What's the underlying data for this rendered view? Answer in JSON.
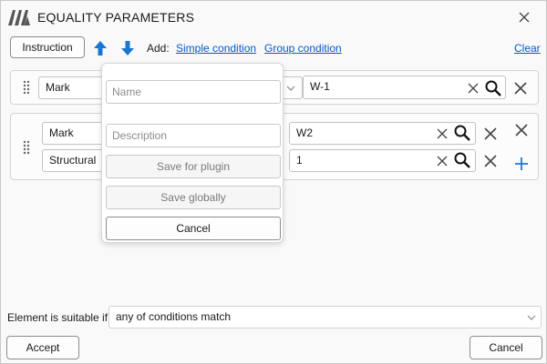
{
  "window": {
    "title": "EQUALITY PARAMETERS",
    "logo_icon": "app-logo-icon",
    "close_icon": "close-icon"
  },
  "toolbar": {
    "instruction_label": "Instruction",
    "move_up_icon": "arrow-up-icon",
    "move_down_icon": "arrow-down-icon",
    "add_label": "Add:",
    "simple_condition_label": "Simple condition",
    "group_condition_label": "Group condition",
    "clear_label": "Clear"
  },
  "conditions": [
    {
      "rows": [
        {
          "parameter": "Mark",
          "value": "W-1"
        }
      ]
    },
    {
      "rows": [
        {
          "parameter": "Mark",
          "value": "W2"
        },
        {
          "parameter": "Structural",
          "value": "1"
        }
      ]
    }
  ],
  "popup": {
    "name_placeholder": "Name",
    "description_placeholder": "Description",
    "save_plugin_label": "Save for plugin",
    "save_global_label": "Save globally",
    "cancel_label": "Cancel"
  },
  "footer": {
    "suitable_label": "Element is suitable if",
    "suitable_value": "any of conditions match",
    "accept_label": "Accept",
    "cancel_label": "Cancel"
  },
  "colors": {
    "accent": "#1976d2",
    "link": "#0a55c8",
    "icon_gray": "#555555"
  }
}
